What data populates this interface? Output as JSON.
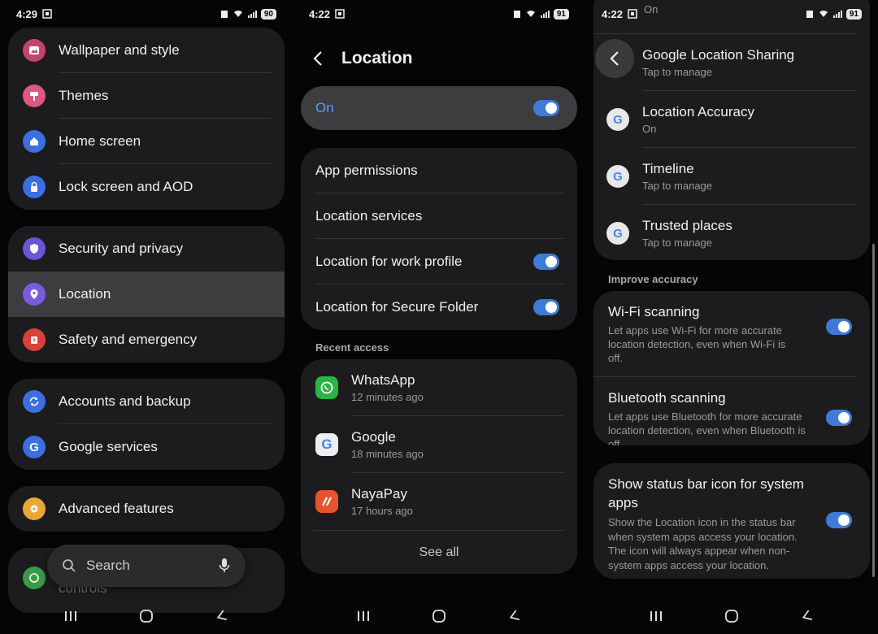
{
  "screen1": {
    "status": {
      "time": "4:29",
      "battery": "90"
    },
    "group1": [
      "Wallpaper and style",
      "Themes",
      "Home screen",
      "Lock screen and AOD"
    ],
    "group2": [
      "Security and privacy",
      "Location",
      "Safety and emergency"
    ],
    "group3": [
      "Accounts and backup",
      "Google services"
    ],
    "group4": [
      "Advanced features"
    ],
    "partial_item": "controls",
    "search": {
      "placeholder": "Search"
    },
    "colors": {
      "wallpaper": "#c2466a",
      "themes": "#e0577e",
      "home": "#3b6fe0",
      "lock": "#3b6fe0",
      "security": "#6b55d8",
      "location": "#7a5be0",
      "safety": "#d8403a",
      "accounts": "#3b6fe0",
      "google": "#3b6fe0",
      "advanced": "#e8a736",
      "digital": "#3a9a48"
    }
  },
  "screen2": {
    "status": {
      "time": "4:22",
      "battery": "91"
    },
    "title": "Location",
    "master_label": "On",
    "settings": [
      "App permissions",
      "Location services",
      "Location for work profile",
      "Location for Secure Folder"
    ],
    "recent_label": "Recent access",
    "recent": [
      {
        "name": "WhatsApp",
        "time": "12 minutes ago"
      },
      {
        "name": "Google",
        "time": "18 minutes ago"
      },
      {
        "name": "NayaPay",
        "time": "17 hours ago"
      }
    ],
    "see_all": "See all"
  },
  "screen3": {
    "status": {
      "time": "4:22",
      "battery": "91"
    },
    "top_partial": "On",
    "google_items": [
      {
        "title": "Google Location Sharing",
        "sub": "Tap to manage"
      },
      {
        "title": "Location Accuracy",
        "sub": "On"
      },
      {
        "title": "Timeline",
        "sub": "Tap to manage"
      },
      {
        "title": "Trusted places",
        "sub": "Tap to manage"
      }
    ],
    "improve_label": "Improve accuracy",
    "wifi": {
      "title": "Wi-Fi scanning",
      "desc": "Let apps use Wi-Fi for more accurate location detection, even when Wi-Fi is off."
    },
    "bt": {
      "title": "Bluetooth scanning",
      "desc": "Let apps use Bluetooth for more accurate location detection, even when Bluetooth is off."
    },
    "statusbar": {
      "title": "Show status bar icon for system apps",
      "desc": "Show the Location icon in the status bar when system apps access your location. The icon will always appear when non-system apps access your location."
    }
  }
}
